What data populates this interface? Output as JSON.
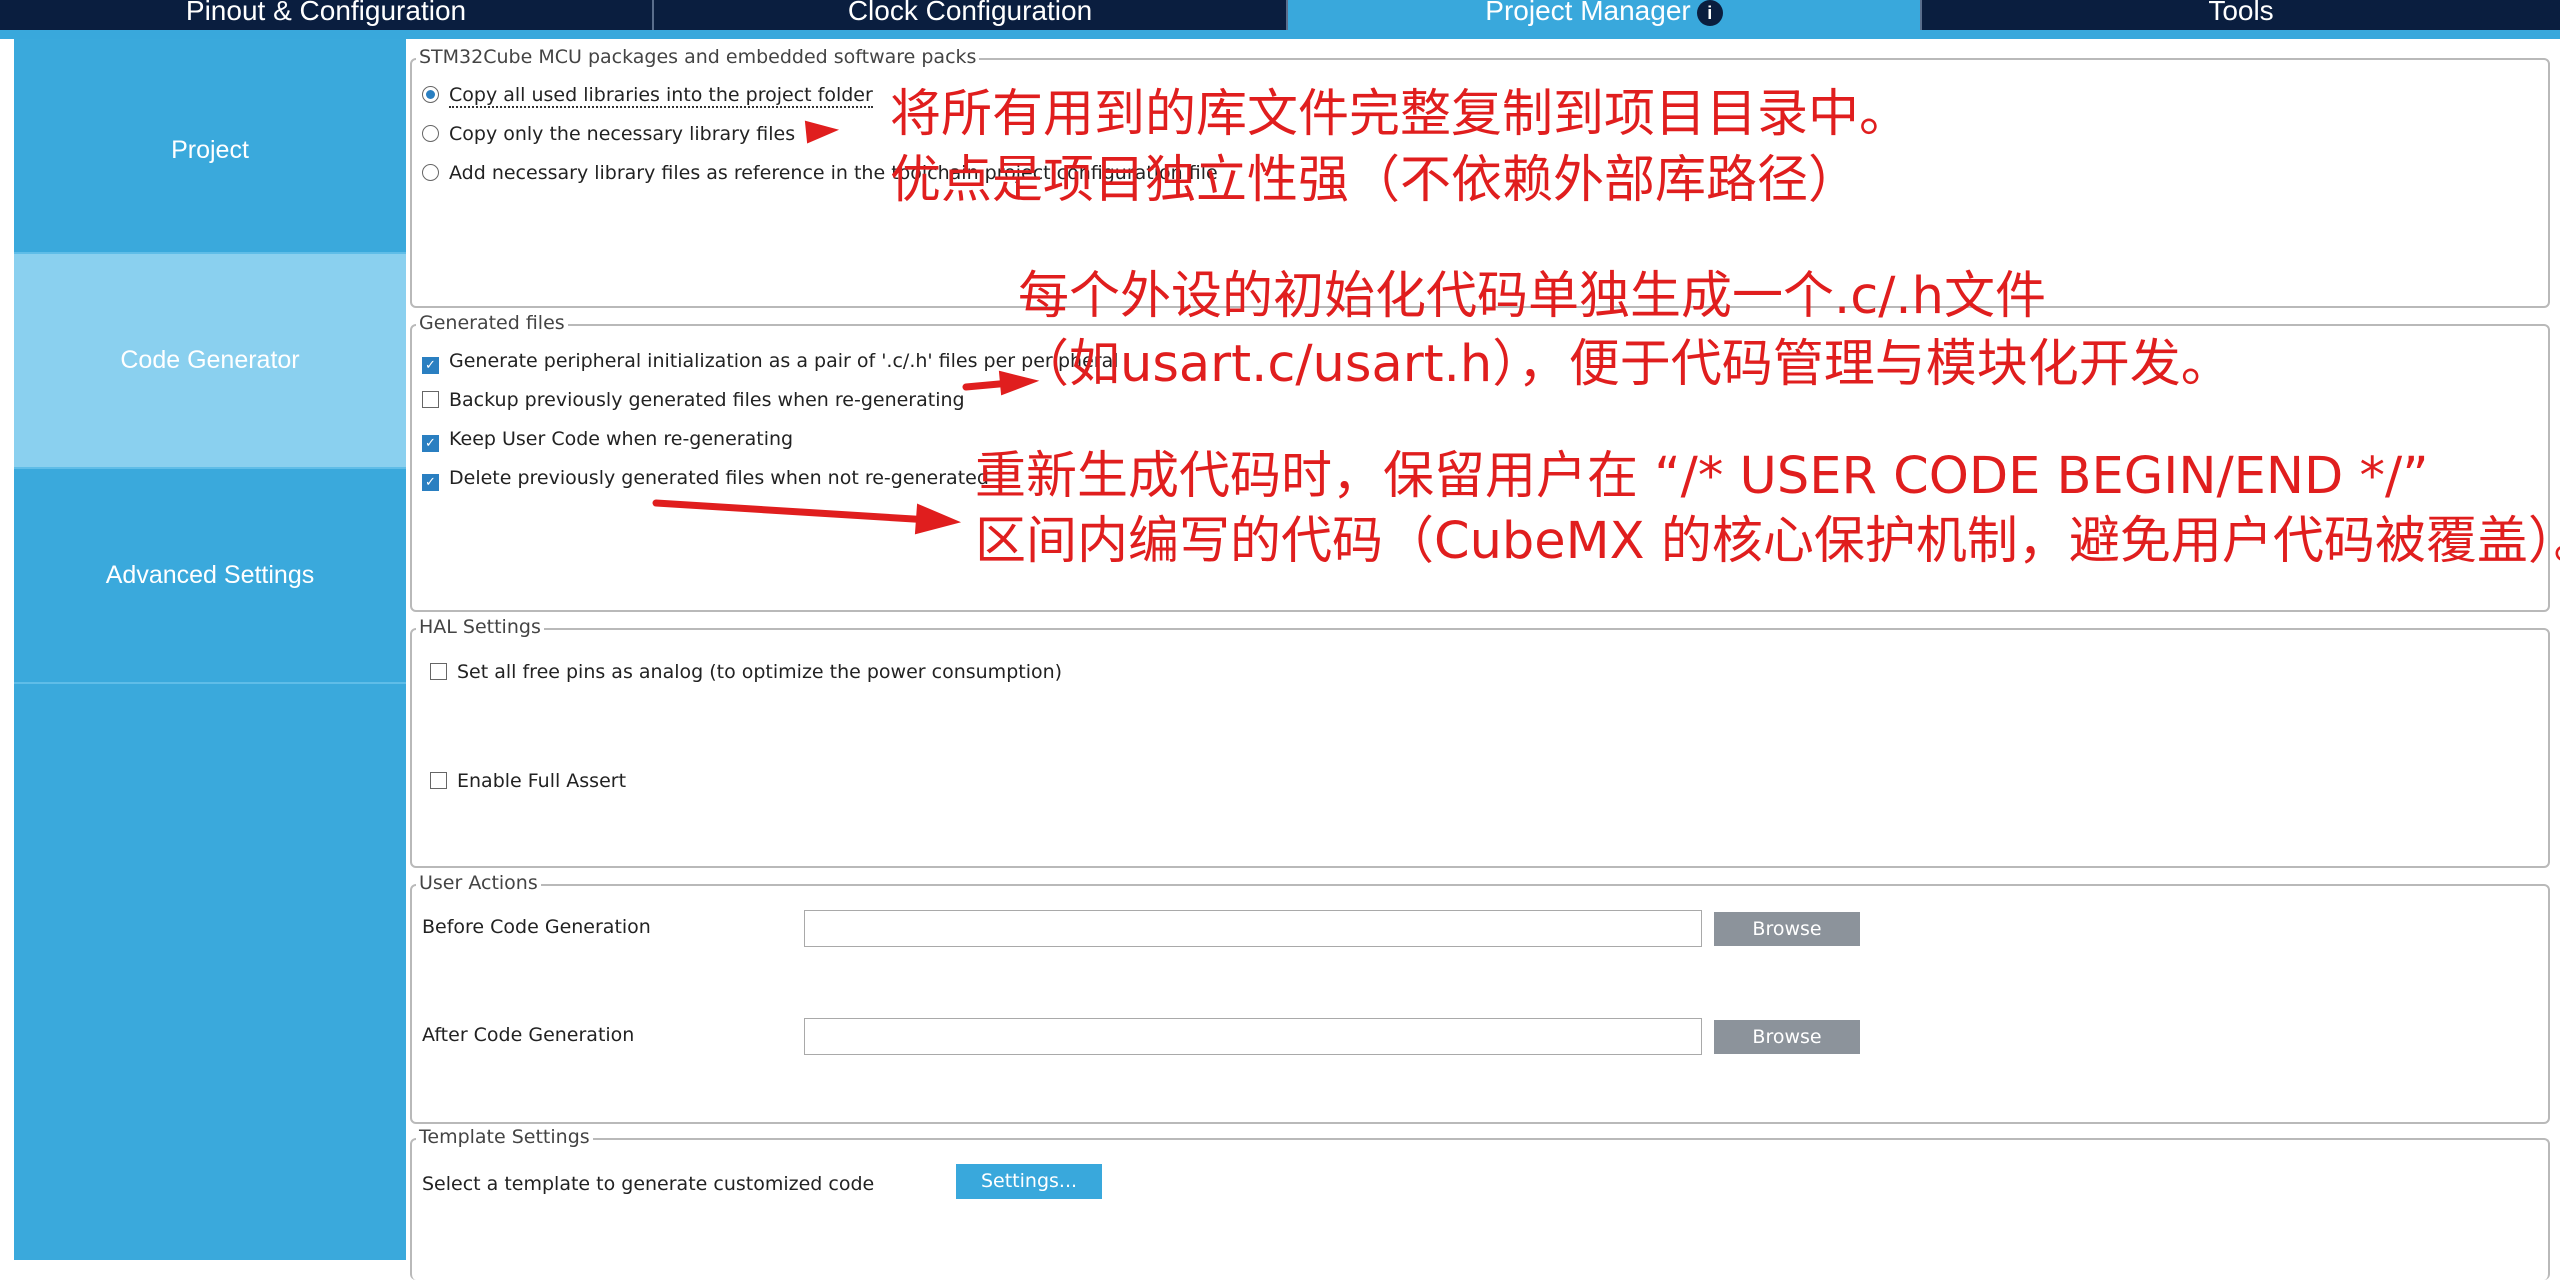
{
  "tabs": [
    {
      "label": "Pinout & Configuration"
    },
    {
      "label": "Clock Configuration"
    },
    {
      "label": "Project Manager"
    },
    {
      "label": "Tools"
    }
  ],
  "sidebar": {
    "items": [
      {
        "label": "Project"
      },
      {
        "label": "Code Generator"
      },
      {
        "label": "Advanced Settings"
      }
    ]
  },
  "packages": {
    "legend": "STM32Cube MCU packages and embedded software packs",
    "options": [
      {
        "label": "Copy all used libraries into the project folder",
        "selected": true
      },
      {
        "label": "Copy only the necessary library files",
        "selected": false
      },
      {
        "label": "Add necessary library files as reference in the toolchain project configuration file",
        "selected": false
      }
    ]
  },
  "generated": {
    "legend": "Generated files",
    "options": [
      {
        "label": "Generate peripheral initialization as a pair of '.c/.h' files per peripheral",
        "checked": true
      },
      {
        "label": "Backup previously generated files when re-generating",
        "checked": false
      },
      {
        "label": "Keep User Code when re-generating",
        "checked": true
      },
      {
        "label": "Delete previously generated files when not re-generated",
        "checked": true
      }
    ]
  },
  "hal": {
    "legend": "HAL Settings",
    "options": [
      {
        "label": "Set all free pins as analog (to optimize the power consumption)",
        "checked": false
      },
      {
        "label": "Enable Full Assert",
        "checked": false
      }
    ]
  },
  "user_actions": {
    "legend": "User Actions",
    "before_label": "Before Code Generation",
    "before_value": "",
    "after_label": "After Code Generation",
    "after_value": "",
    "browse_label": "Browse"
  },
  "template": {
    "legend": "Template Settings",
    "label": "Select a template to generate customized code",
    "button": "Settings..."
  },
  "annotations": {
    "a1_line1": "将所有用到的库文件完整复制到项目目录中。",
    "a1_line2": "优点是项目独立性强（不依赖外部库路径）",
    "a2_line1": "每个外设的初始化代码单独生成一个.c/.h文件",
    "a2_line2": "（如usart.c/usart.h），便于代码管理与模块化开发。",
    "a3_line1": "重新生成代码时，保留用户在 “/* USER CODE BEGIN/END */”",
    "a3_line2": "区间内编写的代码（CubeMX 的核心保护机制，避免用户代码被覆盖）。",
    "color": "#e01e1e"
  }
}
